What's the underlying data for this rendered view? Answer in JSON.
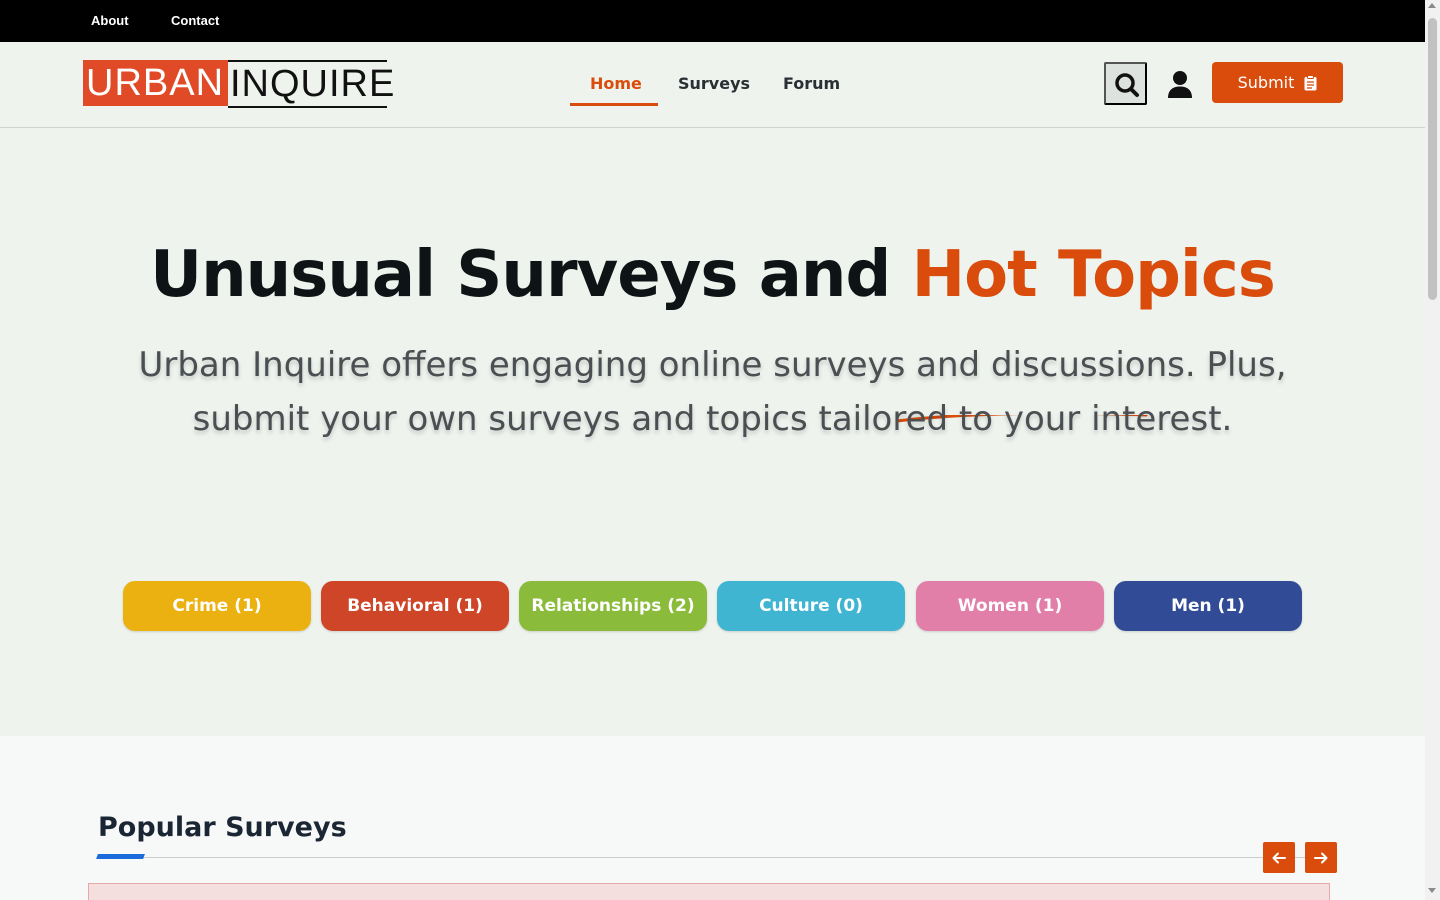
{
  "topbar": {
    "links": [
      "About",
      "Contact"
    ]
  },
  "brand": {
    "part1": "URBAN",
    "part2": "INQUIRE",
    "colors": {
      "accent": "#e04a26"
    }
  },
  "nav": {
    "items": [
      "Home",
      "Surveys",
      "Forum"
    ],
    "active": "Home"
  },
  "header_actions": {
    "search_icon": "search-icon",
    "user_icon": "user-icon",
    "submit_label": "Submit",
    "submit_icon": "clipboard-icon"
  },
  "hero": {
    "title_part1": "Unusual Surveys and",
    "title_part2": "Hot Topics",
    "subtitle": "Urban Inquire offers engaging online surveys and discussions. Plus, submit your own surveys and topics tailored to your interest."
  },
  "categories": [
    {
      "label": "Crime (1)",
      "color": "#ebb111"
    },
    {
      "label": "Behavioral (1)",
      "color": "#cf4527"
    },
    {
      "label": "Relationships (2)",
      "color": "#8bbb3b"
    },
    {
      "label": "Culture (0)",
      "color": "#3fb5d2"
    },
    {
      "label": "Women (1)",
      "color": "#e17fa9"
    },
    {
      "label": "Men (1)",
      "color": "#324b97"
    }
  ],
  "popular": {
    "title": "Popular Surveys",
    "prev_icon": "arrow-left-icon",
    "next_icon": "arrow-right-icon"
  },
  "theme": {
    "primary": "#d94c0c",
    "hero_bg": "#eef3ee",
    "dark": "#0e1416"
  }
}
